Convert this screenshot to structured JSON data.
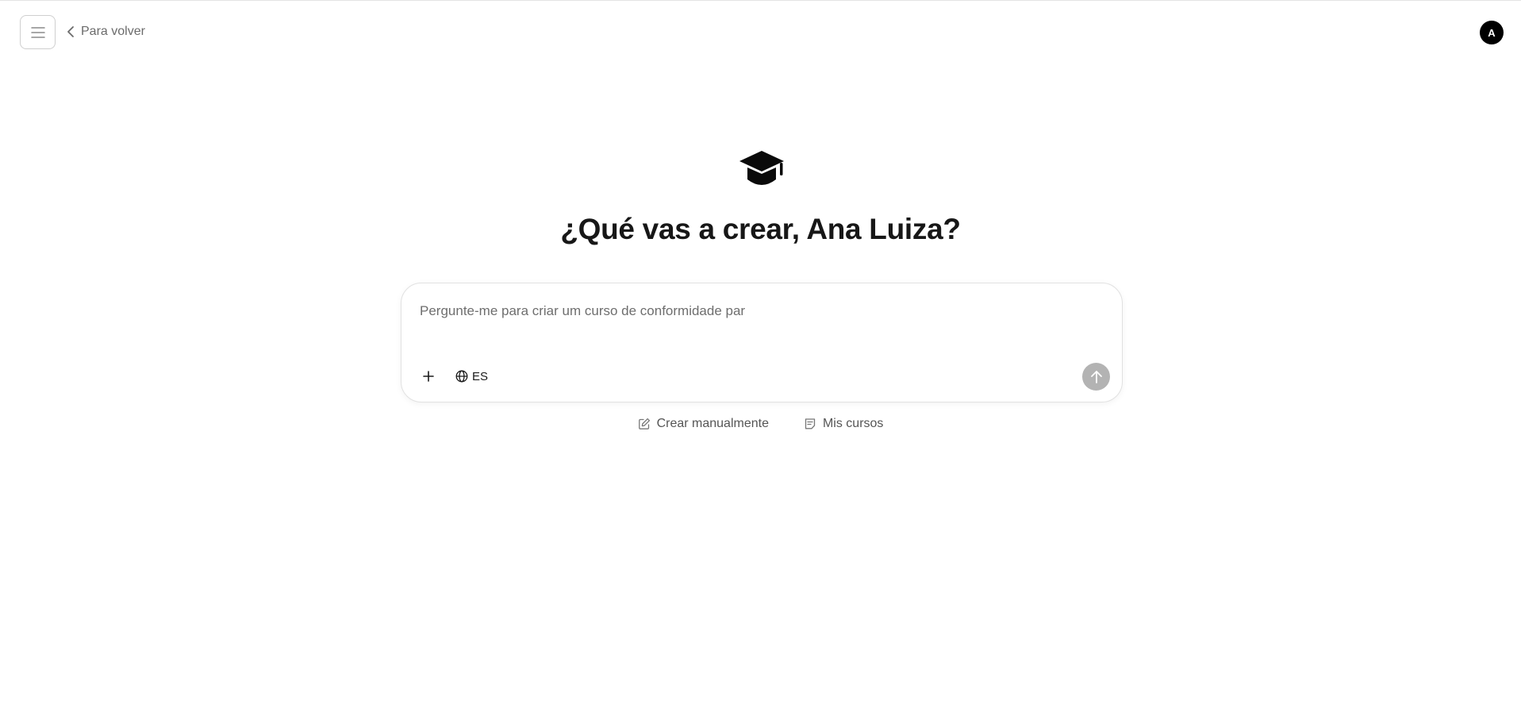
{
  "header": {
    "menu_icon": "hamburger-menu-icon",
    "back_icon": "chevron-left-icon",
    "back_label": "Para volver",
    "avatar_initial": "A"
  },
  "hero": {
    "icon": "graduation-cap-icon",
    "greeting": "¿Qué vas a crear, Ana Luiza?"
  },
  "composer": {
    "input_value": "Pergunte-me para criar um curso de conformidade par",
    "add_icon": "plus-icon",
    "language_icon": "globe-icon",
    "language_label": "ES",
    "send_icon": "arrow-up-icon"
  },
  "links": {
    "create_manual_icon": "edit-icon",
    "create_manual_label": "Crear manualmente",
    "my_courses_icon": "notes-icon",
    "my_courses_label": "Mis cursos"
  },
  "colors": {
    "send_button": "#b3b3b3",
    "avatar_bg": "#000000",
    "muted_text": "#6b6b6b"
  }
}
